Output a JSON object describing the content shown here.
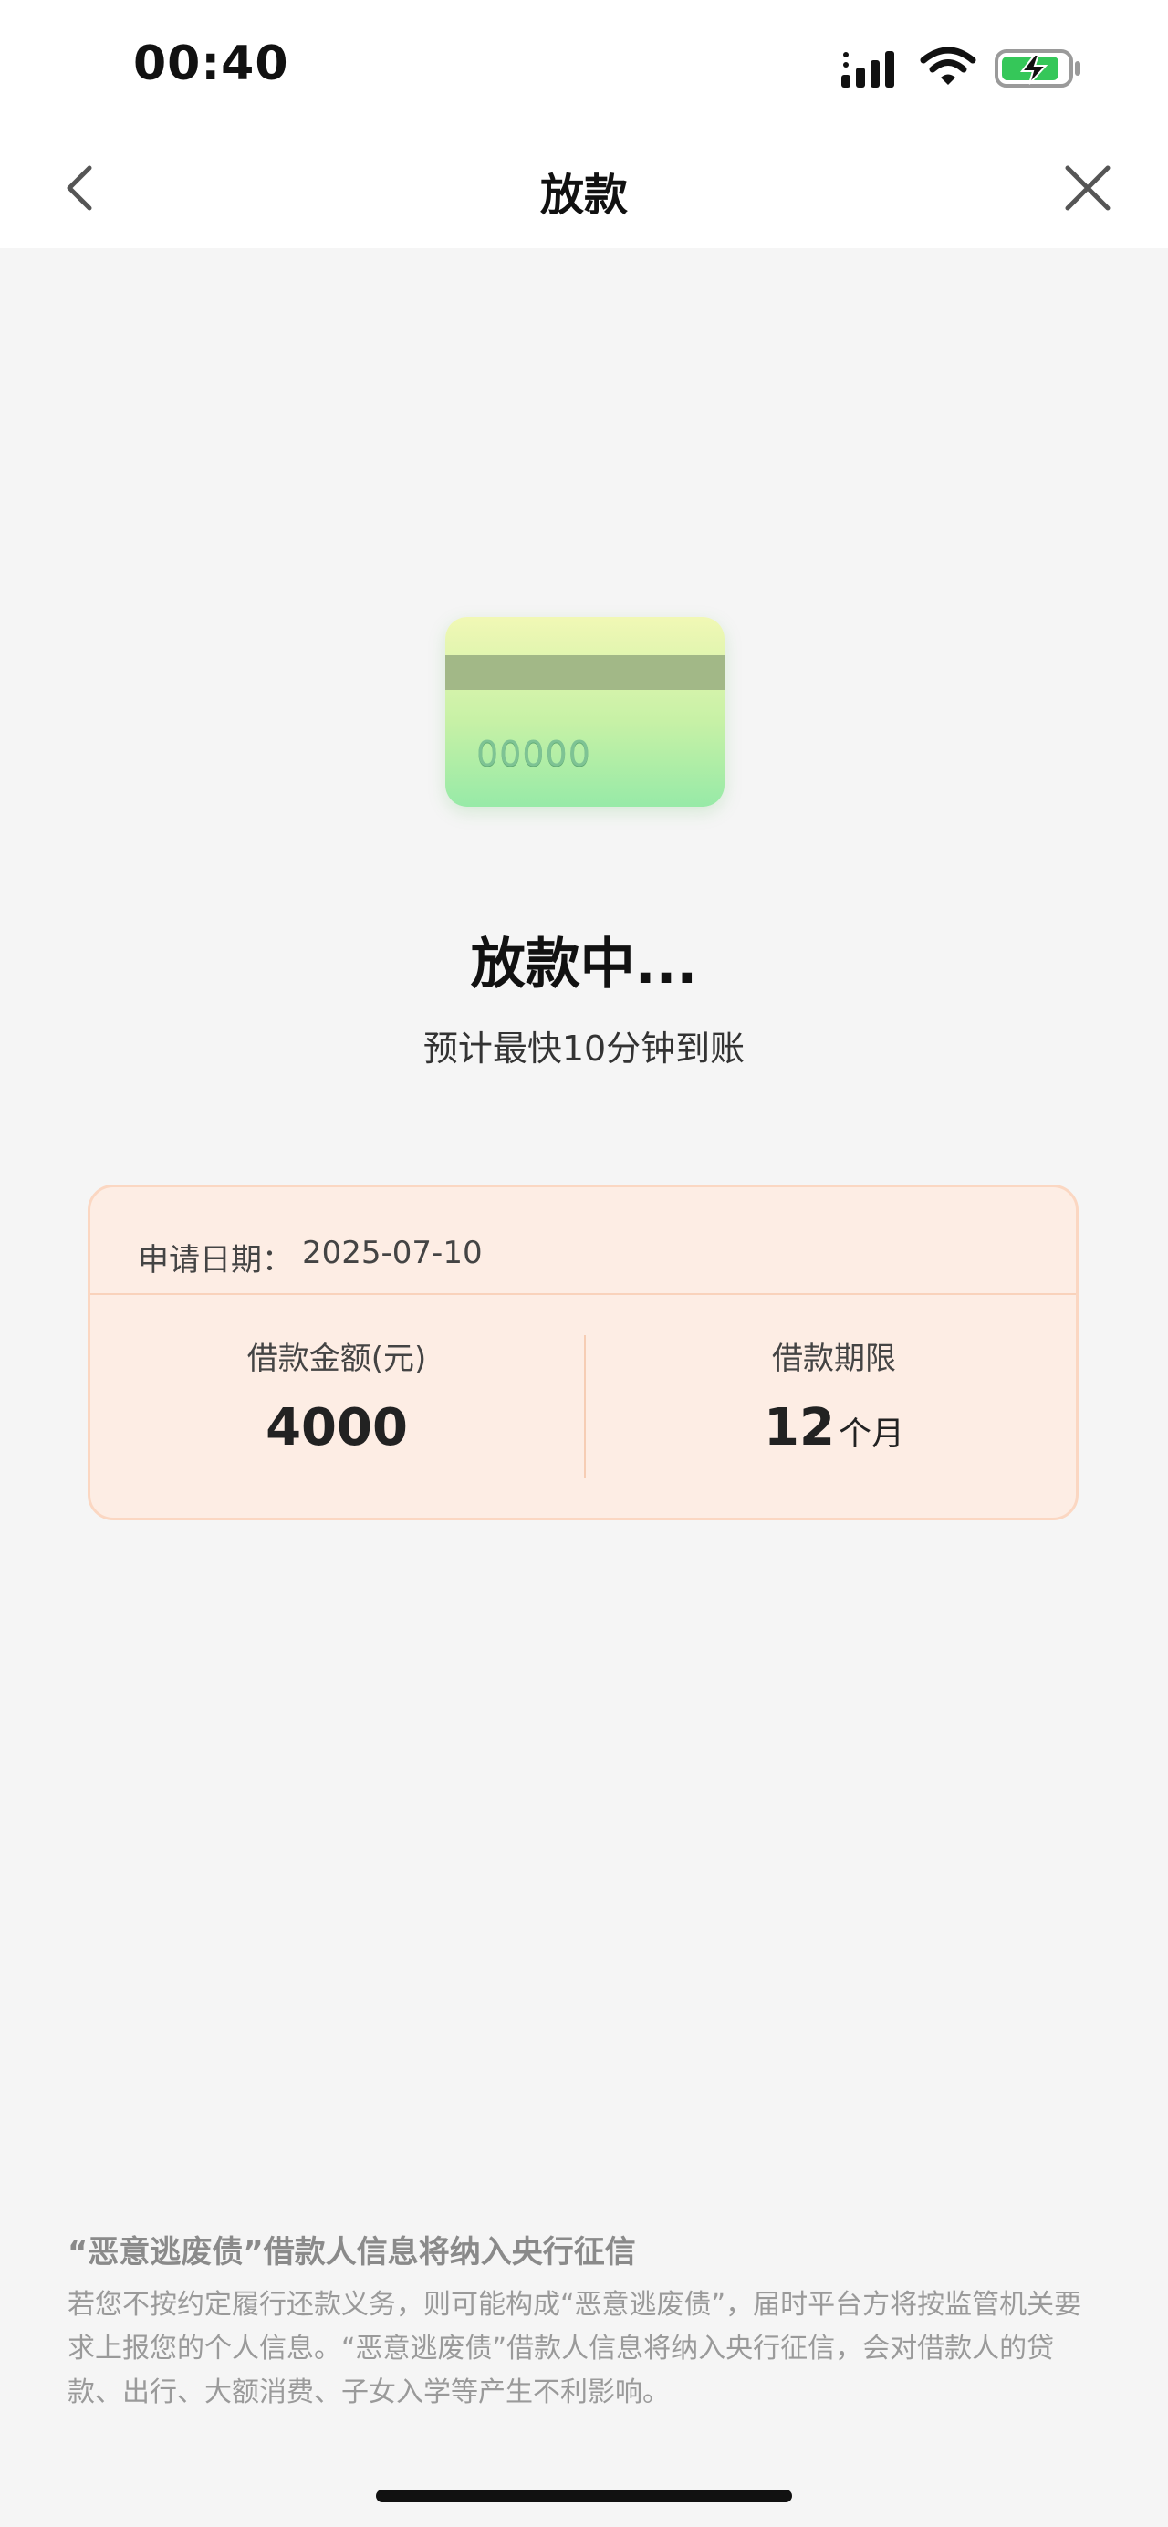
{
  "status_bar": {
    "time": "00:40"
  },
  "nav": {
    "title": "放款"
  },
  "card": {
    "number": "00000"
  },
  "status": {
    "title": "放款中...",
    "subtitle": "预计最快10分钟到账"
  },
  "info": {
    "apply_date_label": "申请日期：",
    "apply_date_value": "2025-07-10",
    "loan_amount_label": "借款金额(元)",
    "loan_amount_value": "4000",
    "loan_term_label": "借款期限",
    "loan_term_value": "12",
    "loan_term_unit": "个月"
  },
  "notice": {
    "title": "“恶意逃废债”借款人信息将纳入央行征信",
    "body": "若您不按约定履行还款义务，则可能构成“恶意逃废债”，届时平台方将按监管机关要求上报您的个人信息。“恶意逃废债”借款人信息将纳入央行征信，会对借款人的贷款、出行、大额消费、子女入学等产生不利影响。"
  }
}
